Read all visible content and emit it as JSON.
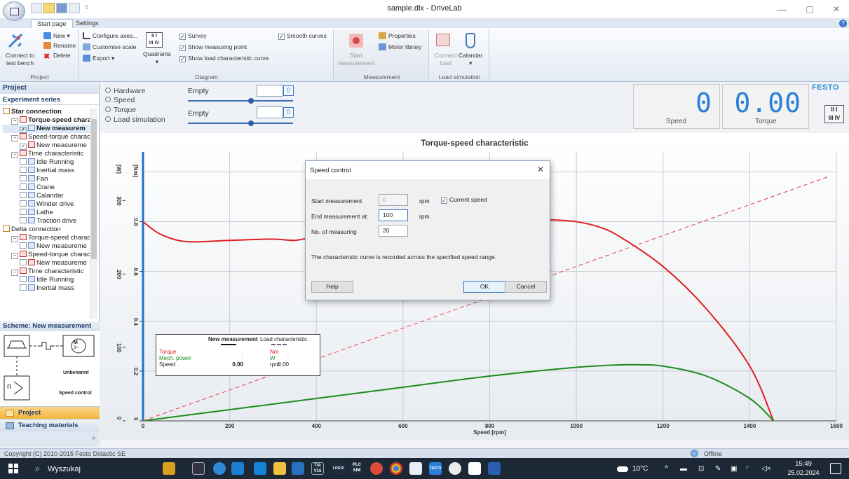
{
  "window": {
    "title": "sample.dlx - DriveLab",
    "minimize": "—",
    "maximize": "▢",
    "close": "✕",
    "help": "?",
    "qat_new": "",
    "qat_open": "",
    "qat_save": "",
    "qat_print": "",
    "qat_more": "="
  },
  "ribbon": {
    "tabs": [
      "Start page",
      "Settings"
    ],
    "project": {
      "connect": "Connect to test bench",
      "connect_line1": "Connect to",
      "connect_line2": "test bench",
      "new": "New",
      "rename": "Rename",
      "delete": "Delete",
      "title": "Project"
    },
    "diagram": {
      "configure_axes": "Configure axes...",
      "customise_scale": "Customise scale",
      "export": "Export",
      "quadrants": "Quadrants",
      "survey": "Survey",
      "show_measuring_point": "Show measuring point",
      "show_load_curve": "Show load characteristic curve",
      "smooth_curves": "Smooth curves",
      "title": "Diagram"
    },
    "measurement": {
      "start_line1": "Start",
      "start_line2": "measurement",
      "properties": "Properties",
      "motor_library": "Motor library",
      "title": "Measurement"
    },
    "load_sim": {
      "connect_line1": "Connect",
      "connect_line2": "load",
      "calandar": "Calandar",
      "title": "Load simulation"
    }
  },
  "left_panel": {
    "project_header": "Project",
    "experiment_series": "Experiment series",
    "tree": [
      {
        "indent": 0,
        "kind": "folder",
        "label": "Star connection",
        "bold": true
      },
      {
        "indent": 1,
        "kind": "group",
        "label": "Torque-speed chara",
        "bold": true
      },
      {
        "indent": 2,
        "kind": "checked",
        "label": "New measurem",
        "bold": true
      },
      {
        "indent": 1,
        "kind": "group",
        "label": "Speed-torque charact",
        "bold": false
      },
      {
        "indent": 2,
        "kind": "checked-red",
        "label": "New measureme",
        "bold": false
      },
      {
        "indent": 1,
        "kind": "group",
        "label": "Time characteristic",
        "bold": false
      },
      {
        "indent": 2,
        "kind": "item",
        "label": "Idle Running",
        "bold": false
      },
      {
        "indent": 2,
        "kind": "item",
        "label": "Inertial mass",
        "bold": false
      },
      {
        "indent": 2,
        "kind": "item",
        "label": "Fan",
        "bold": false
      },
      {
        "indent": 2,
        "kind": "item",
        "label": "Crane",
        "bold": false
      },
      {
        "indent": 2,
        "kind": "item",
        "label": "Calandar",
        "bold": false
      },
      {
        "indent": 2,
        "kind": "item",
        "label": "Winder drive",
        "bold": false
      },
      {
        "indent": 2,
        "kind": "item",
        "label": "Lathe",
        "bold": false
      },
      {
        "indent": 2,
        "kind": "item",
        "label": "Traction drive",
        "bold": false
      },
      {
        "indent": 0,
        "kind": "folder",
        "label": "Delta connection",
        "bold": false
      },
      {
        "indent": 1,
        "kind": "group",
        "label": "Torque-speed charact",
        "bold": false
      },
      {
        "indent": 2,
        "kind": "item-blue",
        "label": "New measureme",
        "bold": false
      },
      {
        "indent": 1,
        "kind": "group",
        "label": "Speed-torque charact",
        "bold": false
      },
      {
        "indent": 2,
        "kind": "item-red",
        "label": "New measureme",
        "bold": false
      },
      {
        "indent": 1,
        "kind": "group",
        "label": "Time characteristic",
        "bold": false
      },
      {
        "indent": 2,
        "kind": "item",
        "label": "Idle Running",
        "bold": false
      },
      {
        "indent": 2,
        "kind": "item",
        "label": "Inertial mass",
        "bold": false
      }
    ],
    "scheme_header": "Scheme: New measurement",
    "scheme_unbenannt": "Unbenannt",
    "scheme_speed_control": "Speed control",
    "scheme_m": "M",
    "scheme_3": "3~",
    "scheme_n": "n",
    "nav_project": "Project",
    "nav_teaching": "Teaching materials",
    "nav_more": "»"
  },
  "controls": {
    "radio_hardware": "Hardware",
    "radio_speed": "Speed",
    "radio_torque": "Torque",
    "radio_load_sim": "Load simulation",
    "empty1": "Empty",
    "empty2": "Empty",
    "slider1_value": 0.6,
    "slider2_value": 0.6
  },
  "meters": {
    "speed_value": "0",
    "speed_label": "Speed",
    "torque_value": "0.00",
    "torque_label": "Torque",
    "brand": "FESTO"
  },
  "chart_data": {
    "type": "line",
    "title": "Torque-speed characteristic",
    "xlabel": "Speed [rpm]",
    "xlim": [
      0,
      1600
    ],
    "x_ticks": [
      0,
      200,
      400,
      600,
      800,
      1000,
      1200,
      1400,
      1600
    ],
    "y_axes": [
      {
        "label": "[W]",
        "ticks": [
          0,
          100,
          200,
          300
        ]
      },
      {
        "label": "[Nm]",
        "ticks": [
          0,
          0.2,
          0.4,
          0.6,
          0.8
        ]
      }
    ],
    "ylim_torque": [
      0,
      1.08
    ],
    "grid": true,
    "series": [
      {
        "name": "Torque",
        "color": "#e02020",
        "style": "solid",
        "x": [
          0,
          40,
          100,
          200,
          300,
          350,
          400,
          500,
          600,
          700,
          800,
          900,
          950,
          1000,
          1050,
          1100,
          1200,
          1300,
          1400,
          1455
        ],
        "y": [
          0.8,
          0.75,
          0.72,
          0.725,
          0.73,
          0.725,
          0.74,
          0.76,
          0.78,
          0.8,
          0.81,
          0.81,
          0.807,
          0.8,
          0.78,
          0.74,
          0.62,
          0.45,
          0.22,
          0.0
        ]
      },
      {
        "name": "Mech. power",
        "color": "#1e8c1e",
        "style": "solid",
        "x": [
          0,
          200,
          400,
          600,
          800,
          1000,
          1100,
          1150,
          1200,
          1300,
          1400,
          1455
        ],
        "y": [
          0.0,
          0.045,
          0.09,
          0.135,
          0.18,
          0.215,
          0.225,
          0.225,
          0.22,
          0.18,
          0.09,
          0.0
        ]
      },
      {
        "name": "Load characteristic",
        "color": "#e04040",
        "style": "dashed",
        "x": [
          0,
          1580
        ],
        "y": [
          0.0,
          0.98
        ]
      }
    ]
  },
  "legend": {
    "col_new": "New measurement",
    "col_load": "Load characteristic",
    "rows": [
      {
        "name": "Torque",
        "v1": "-",
        "v2": "-",
        "unit": "Nm",
        "color": "#e02020"
      },
      {
        "name": "Mech. power",
        "v1": "-",
        "v2": "-",
        "unit": "W",
        "color": "#1e8c1e"
      },
      {
        "name": "Speed",
        "v1": "0.00",
        "v2": "0.00",
        "unit": "rpm",
        "color": "#222222"
      }
    ]
  },
  "dialog": {
    "title": "Speed control",
    "start_label": "Start measurement",
    "start_value": "0",
    "start_unit": "rpm",
    "current_speed": "Current speed",
    "end_label": "End measurement at:",
    "end_value": "100",
    "end_unit": "rpm",
    "count_label": "No. of measuring",
    "count_value": "20",
    "info": "The characteristic curve is recorded across the specified speed range.",
    "help": "Help",
    "ok": "OK",
    "cancel": "Cancel",
    "close": "✕"
  },
  "status": {
    "copyright": "Copyright (C) 2010-2015 Festo Didactic SE",
    "connection": "Offline"
  },
  "taskbar": {
    "search": "Wyszukaj",
    "weather": "10°C",
    "time": "15:49",
    "date": "25.02.2024",
    "tia": "TIA V15",
    "logo": "LOGO!",
    "plc": "PLC SIM",
    "festo": "FESTO"
  },
  "colors": {
    "accent": "#2a7fd8",
    "torque": "#e02020",
    "power": "#1e8c1e",
    "nav_project": "#f5b43c"
  }
}
